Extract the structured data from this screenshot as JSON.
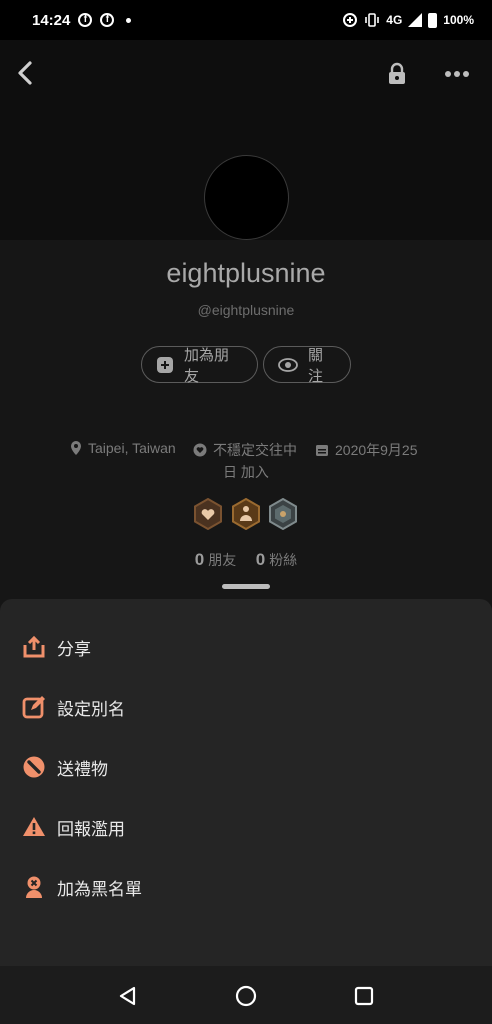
{
  "status_bar": {
    "time": "14:24",
    "network": "4G",
    "battery": "100%",
    "icons": [
      "facebook-icon",
      "facebook-icon",
      "notification-dot",
      "data-saver-icon",
      "vibrate-icon",
      "signal-icon",
      "battery-icon"
    ]
  },
  "header": {
    "back_icon": "back-arrow-icon",
    "lock_icon": "lock-icon",
    "more_icon": "more-options-icon"
  },
  "profile": {
    "display_name": "eightplusnine",
    "handle": "@eightplusnine",
    "add_friend_label": "加為朋友",
    "follow_label": "關注",
    "location": "Taipei, Taiwan",
    "relationship": "不穩定交往中",
    "joined_line1": "2020年9月25",
    "joined_line2": "日 加入",
    "friends_count": "0",
    "friends_label": "朋友",
    "followers_count": "0",
    "followers_label": "粉絲"
  },
  "menu": {
    "share": "分享",
    "set_alias": "設定別名",
    "send_gift": "送禮物",
    "report": "回報濫用",
    "block": "加為黑名單"
  },
  "colors": {
    "accent": "#f0906b",
    "background": "#151515",
    "sheet": "#252525"
  }
}
